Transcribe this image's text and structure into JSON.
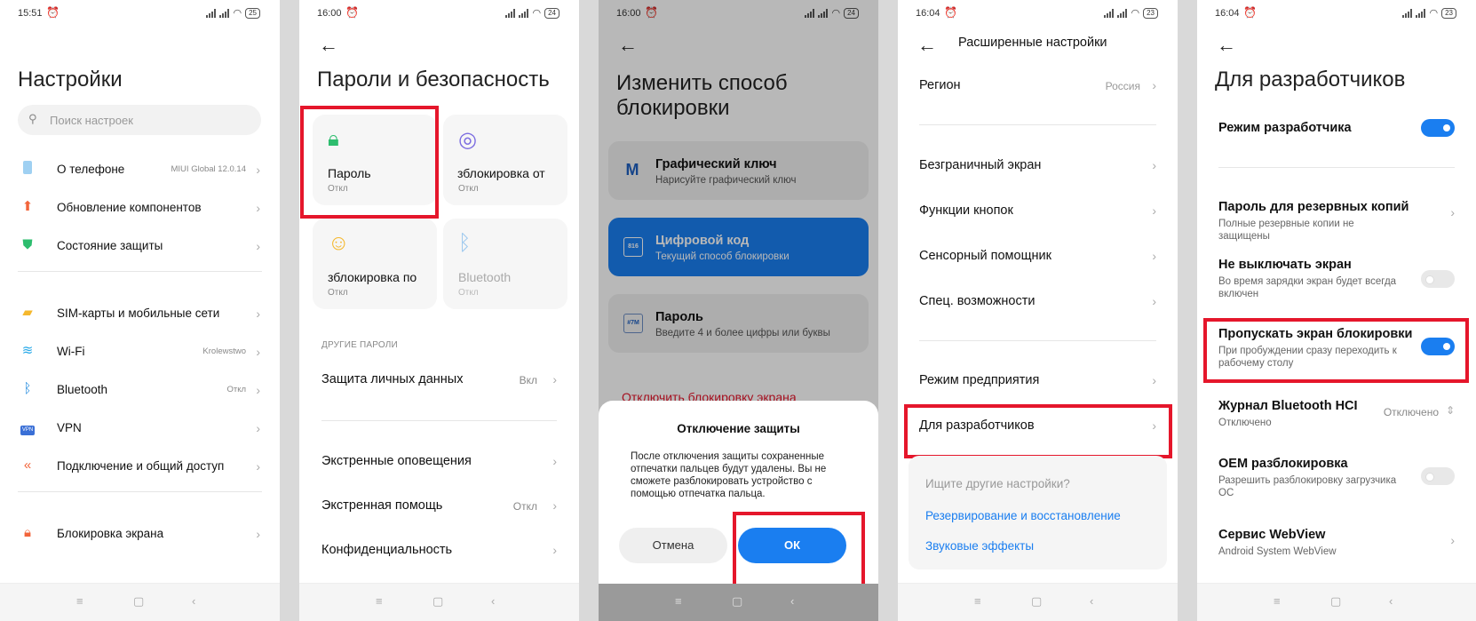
{
  "status": {
    "s1_time": "15:51",
    "s1_batt": "25",
    "s2_time": "16:00",
    "s2_batt": "24",
    "s3_time": "16:00",
    "s3_batt": "24",
    "s4_time": "16:04",
    "s4_batt": "23",
    "s5_time": "16:04",
    "s5_batt": "23"
  },
  "settings": {
    "title": "Настройки",
    "search_placeholder": "Поиск настроек",
    "items": [
      {
        "label": "О телефоне",
        "value": "MIUI Global 12.0.14"
      },
      {
        "label": "Обновление компонентов",
        "value": ""
      },
      {
        "label": "Состояние защиты",
        "value": ""
      },
      {
        "label": "SIM-карты и мобильные сети",
        "value": ""
      },
      {
        "label": "Wi-Fi",
        "value": "Krolewstwo"
      },
      {
        "label": "Bluetooth",
        "value": "Откл"
      },
      {
        "label": "VPN",
        "value": ""
      },
      {
        "label": "Подключение и общий доступ",
        "value": ""
      },
      {
        "label": "Блокировка экрана",
        "value": ""
      }
    ]
  },
  "security": {
    "title": "Пароли и безопасность",
    "tiles": [
      {
        "label": "Пароль",
        "status": "Откл"
      },
      {
        "label": "зблокировка от",
        "status": "Откл"
      },
      {
        "label": "зблокировка по",
        "status": "Откл"
      },
      {
        "label": "Bluetooth",
        "status": "Откл"
      }
    ],
    "section_other": "ДРУГИЕ ПАРОЛИ",
    "privacy_label": "Защита личных данных",
    "privacy_value": "Вкл",
    "rows": [
      {
        "label": "Экстренные оповещения",
        "value": ""
      },
      {
        "label": "Экстренная помощь",
        "value": "Откл"
      },
      {
        "label": "Конфиденциальность",
        "value": ""
      }
    ]
  },
  "lockmethod": {
    "title_line1": "Изменить способ",
    "title_line2": "блокировки",
    "options": [
      {
        "icon": "M",
        "title": "Графический ключ",
        "subtitle": "Нарисуйте графический ключ"
      },
      {
        "icon": "816",
        "title": "Цифровой код",
        "subtitle": "Текущий способ блокировки"
      },
      {
        "icon": "#7M",
        "title": "Пароль",
        "subtitle": "Введите 4 и более цифры или буквы"
      }
    ],
    "disable_link": "Отключить блокировку экрана",
    "dialog": {
      "title": "Отключение защиты",
      "text": "После отключения защиты сохраненные отпечатки пальцев будут удалены. Вы не сможете разблокировать устройство с помощью отпечатка пальца.",
      "cancel": "Отмена",
      "ok": "ОК"
    }
  },
  "advanced": {
    "title": "Расширенные настройки",
    "region_label": "Регион",
    "region_value": "Россия",
    "rows": [
      "Безграничный экран",
      "Функции кнопок",
      "Сенсорный помощник",
      "Спец. возможности",
      "Режим предприятия",
      "Для разработчиков"
    ],
    "search_card": {
      "title": "Ищите другие настройки?",
      "links": [
        "Резервирование и восстановление",
        "Звуковые эффекты"
      ]
    }
  },
  "developer": {
    "title": "Для разработчиков",
    "dev_mode": "Режим разработчика",
    "items": [
      {
        "title": "Пароль для резервных копий",
        "desc": "Полные резервные копии не защищены"
      },
      {
        "title": "Не выключать экран",
        "desc": "Во время зарядки экран будет всегда включен"
      },
      {
        "title": "Пропускать экран блокировки",
        "desc": "При пробуждении сразу переходить к рабочему столу"
      },
      {
        "title": "Журнал Bluetooth HCI",
        "desc": "Отключено",
        "value": "Отключено"
      },
      {
        "title": "OEM разблокировка",
        "desc": "Разрешить разблокировку загрузчика ОС"
      },
      {
        "title": "Сервис WebView",
        "desc": "Android System WebView"
      }
    ]
  },
  "colors": {
    "accent": "#1a7ef0",
    "highlight": "#e5162b"
  }
}
